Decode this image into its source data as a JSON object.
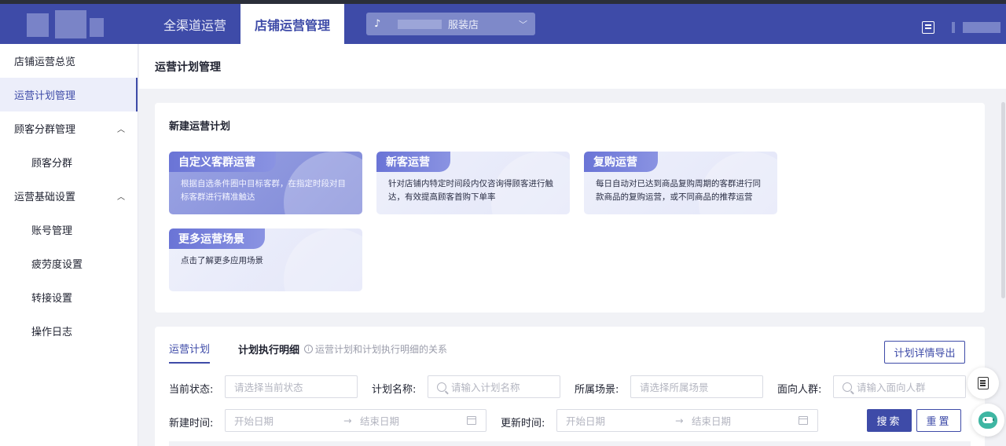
{
  "topbar": {
    "tabs": [
      "全渠道运营",
      "店铺运营管理"
    ],
    "active_tab": 1,
    "store_selector": {
      "value": "服装店",
      "icon": "tiktok-icon"
    }
  },
  "sidebar": {
    "items": [
      {
        "label": "店铺运营总览"
      },
      {
        "label": "运营计划管理"
      },
      {
        "label": "顾客分群管理"
      },
      {
        "label": "顾客分群"
      },
      {
        "label": "运营基础设置"
      },
      {
        "label": "账号管理"
      },
      {
        "label": "疲劳度设置"
      },
      {
        "label": "转接设置"
      },
      {
        "label": "操作日志"
      }
    ]
  },
  "page": {
    "title": "运营计划管理"
  },
  "new_plan": {
    "title": "新建运营计划",
    "scenes": [
      {
        "name": "自定义客群运营",
        "desc": "根据自选条件圈中目标客群，在指定时段对目标客群进行精准触达"
      },
      {
        "name": "新客运营",
        "desc": "针对店铺内特定时间段内仅咨询得顾客进行触达，有效提高顾客首购下单率"
      },
      {
        "name": "复购运营",
        "desc": "每日自动对已达到商品复购周期的客群进行同款商品的复购运营，或不同商品的推荐运营"
      },
      {
        "name": "更多运营场景",
        "desc": "点击了解更多应用场景"
      }
    ]
  },
  "list": {
    "tabs": [
      "运营计划",
      "计划执行明细"
    ],
    "note": "运营计划和计划执行明细的关系",
    "export_label": "计划详情导出",
    "filters": {
      "status": {
        "label": "当前状态:",
        "placeholder": "请选择当前状态"
      },
      "name": {
        "label": "计划名称:",
        "placeholder": "请输入计划名称"
      },
      "scene": {
        "label": "所属场景:",
        "placeholder": "请选择所属场景"
      },
      "audience": {
        "label": "面向人群:",
        "placeholder": "请输入面向人群"
      },
      "created": {
        "label": "新建时间:",
        "start": "开始日期",
        "end": "结束日期"
      },
      "updated": {
        "label": "更新时间:",
        "start": "开始日期",
        "end": "结束日期"
      }
    },
    "search_label": "搜索",
    "reset_label": "重置"
  },
  "colors": {
    "brand": "#3e4ba8",
    "scene_bg": "#e3e6f8",
    "highlight": "#7f89d8"
  }
}
